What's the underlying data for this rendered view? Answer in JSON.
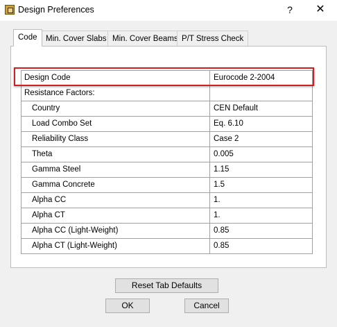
{
  "window": {
    "title": "Design Preferences",
    "help": "?",
    "close": "✕"
  },
  "tabs": [
    {
      "label": "Code",
      "active": true
    },
    {
      "label": "Min. Cover Slabs"
    },
    {
      "label": "Min. Cover Beams"
    },
    {
      "label": "P/T Stress Check"
    }
  ],
  "grid": {
    "rows": [
      {
        "key": "Design Code",
        "value": "Eurocode 2-2004"
      },
      {
        "key": "Resistance Factors:",
        "value": ""
      },
      {
        "key": "Country",
        "value": "CEN Default"
      },
      {
        "key": "Load Combo Set",
        "value": "Eq. 6.10"
      },
      {
        "key": "Reliability Class",
        "value": "Case 2"
      },
      {
        "key": "Theta",
        "value": "0.005"
      },
      {
        "key": "Gamma Steel",
        "value": "1.15"
      },
      {
        "key": "Gamma Concrete",
        "value": "1.5"
      },
      {
        "key": "Alpha CC",
        "value": "1."
      },
      {
        "key": "Alpha CT",
        "value": "1."
      },
      {
        "key": "Alpha CC (Light-Weight)",
        "value": "0.85"
      },
      {
        "key": "Alpha CT (Light-Weight)",
        "value": "0.85"
      }
    ]
  },
  "buttons": {
    "reset": "Reset Tab Defaults",
    "ok": "OK",
    "cancel": "Cancel"
  },
  "colors": {
    "highlight": "#d31f1f"
  }
}
